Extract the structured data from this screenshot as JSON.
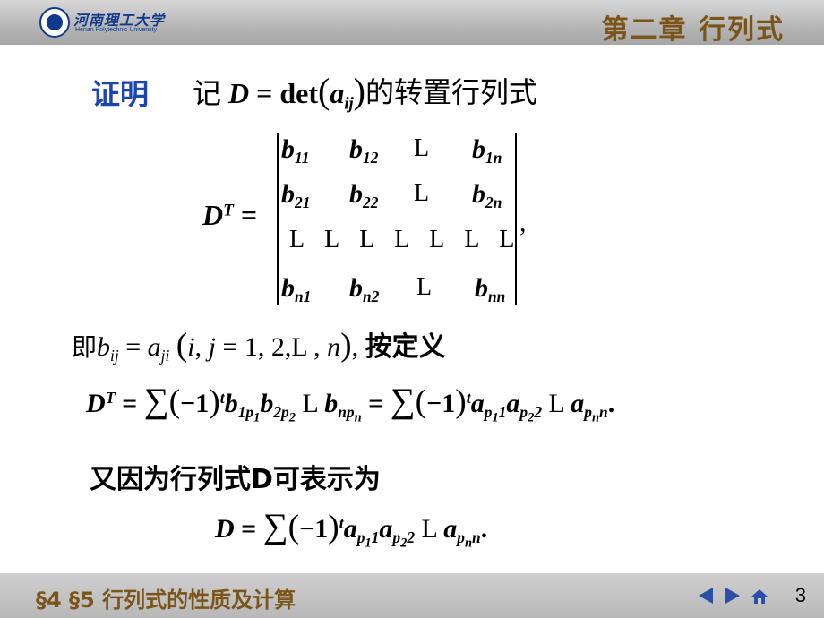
{
  "header": {
    "logo_cn": "河南理工大学",
    "logo_en": "Henan Polytechnic University",
    "chapter": "第二章  行列式"
  },
  "slide": {
    "proof_label": "证明",
    "line1_prefix": "记",
    "line1_suffix": "的转置行列式",
    "ellipsis": "L",
    "def_text": "按定义",
    "line_d_text": "又因为行列式D可表示为"
  },
  "footer": {
    "section": "§4  §5  行列式的性质及计算",
    "page_number": "3"
  },
  "icons": [
    "prev-arrow-icon",
    "next-arrow-icon",
    "home-icon"
  ],
  "colors": {
    "header_text": "#7a5418",
    "proof_label": "#1a46b4",
    "nav_arrow": "#2b4fa8"
  }
}
